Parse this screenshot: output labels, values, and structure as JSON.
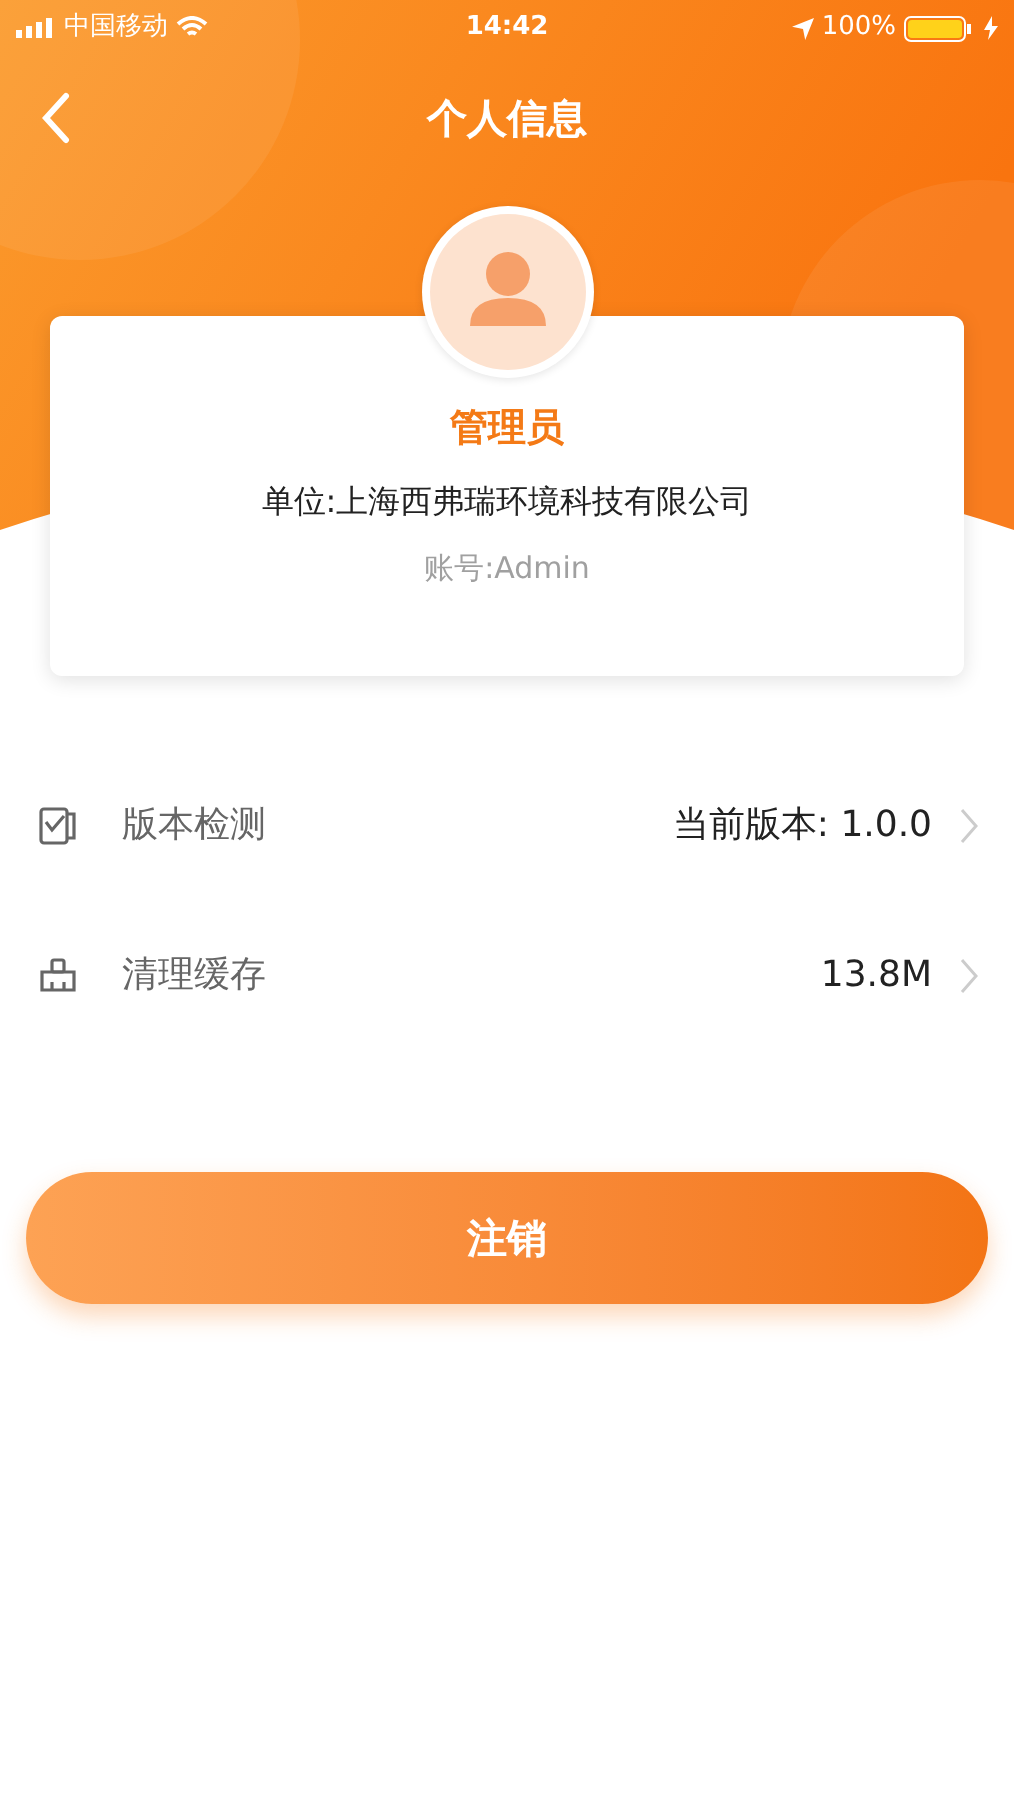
{
  "status_bar": {
    "carrier": "中国移动",
    "time": "14:42",
    "battery": "100%"
  },
  "nav": {
    "title": "个人信息"
  },
  "profile": {
    "name": "管理员",
    "unit": "单位:上海西弗瑞环境科技有限公司",
    "account": "账号:Admin"
  },
  "settings": [
    {
      "kind": "version",
      "label": "版本检测",
      "value": "当前版本: 1.0.0"
    },
    {
      "kind": "cache",
      "label": "清理缓存",
      "value": "13.8M"
    }
  ],
  "logout_button": "注销"
}
